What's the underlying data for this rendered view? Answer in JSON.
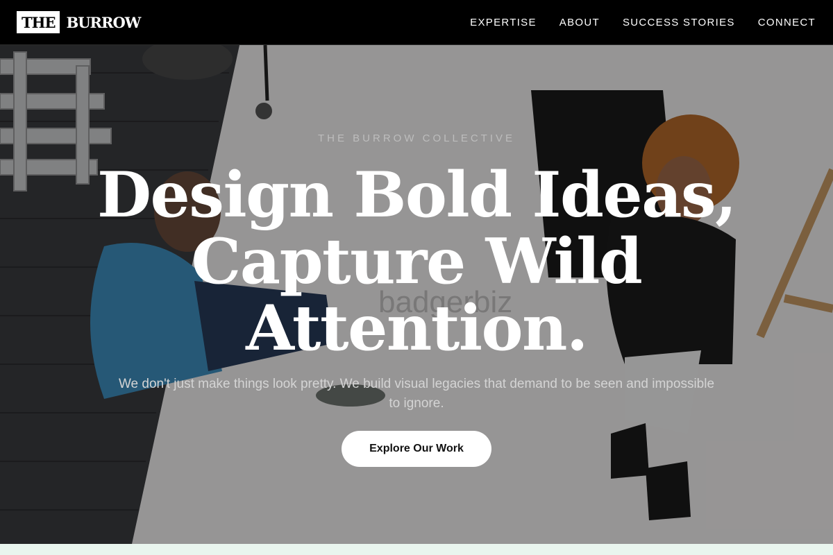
{
  "header": {
    "logo_box": "THE",
    "logo_text": "BURROW",
    "nav": [
      "EXPERTISE",
      "ABOUT",
      "SUCCESS STORIES",
      "CONNECT"
    ]
  },
  "hero": {
    "eyebrow": "THE BURROW COLLECTIVE",
    "headline": "Design Bold Ideas, Capture Wild Attention.",
    "subtext": "We don't just make things look pretty. We build visual legacies that demand to be seen and impossible to ignore.",
    "cta_label": "Explore Our Work",
    "watermark": "badgerbiz"
  },
  "colors": {
    "header_bg": "#000000",
    "cta_bg": "#ffffff"
  }
}
